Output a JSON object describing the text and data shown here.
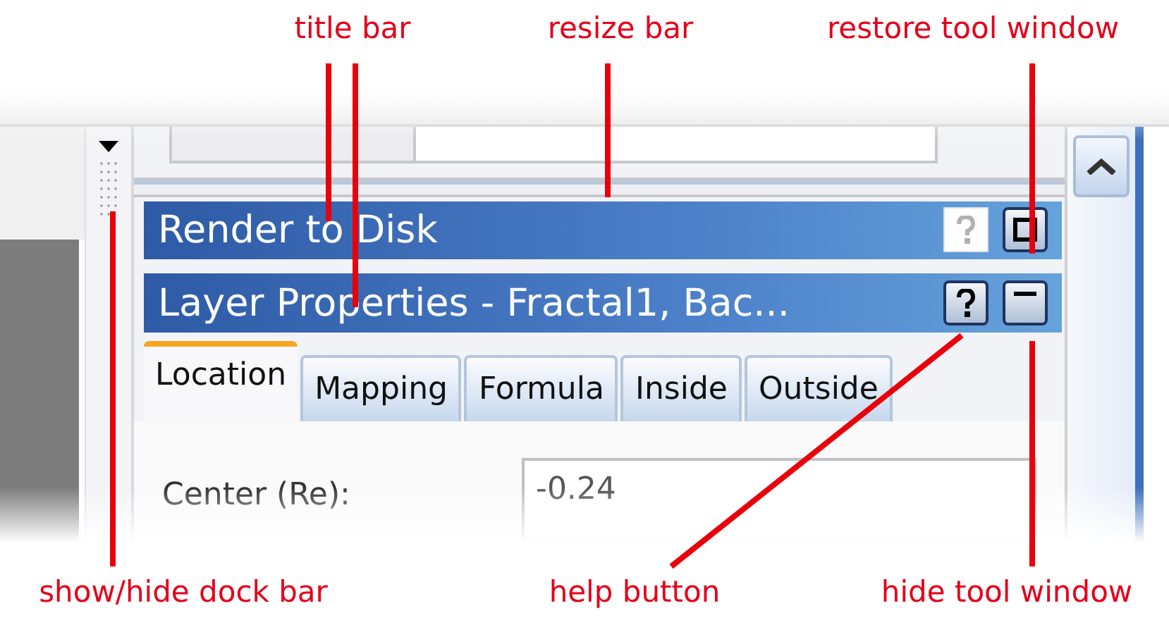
{
  "callouts": {
    "top": [
      {
        "label": "title bar"
      },
      {
        "label": "resize bar"
      },
      {
        "label": "restore tool window"
      }
    ],
    "bottom": [
      {
        "label": "show/hide dock bar"
      },
      {
        "label": "help button"
      },
      {
        "label": "hide tool window"
      }
    ]
  },
  "tool_windows": [
    {
      "title": "Render to Disk",
      "active": false
    },
    {
      "title": "Layer Properties - Fractal1, Bac...",
      "active": true
    }
  ],
  "tabs": [
    {
      "label": "Location",
      "selected": true
    },
    {
      "label": "Mapping",
      "selected": false
    },
    {
      "label": "Formula",
      "selected": false
    },
    {
      "label": "Inside",
      "selected": false
    },
    {
      "label": "Outside",
      "selected": false
    }
  ],
  "fields": [
    {
      "label": "Center (Re):",
      "value": "-0.24"
    }
  ]
}
